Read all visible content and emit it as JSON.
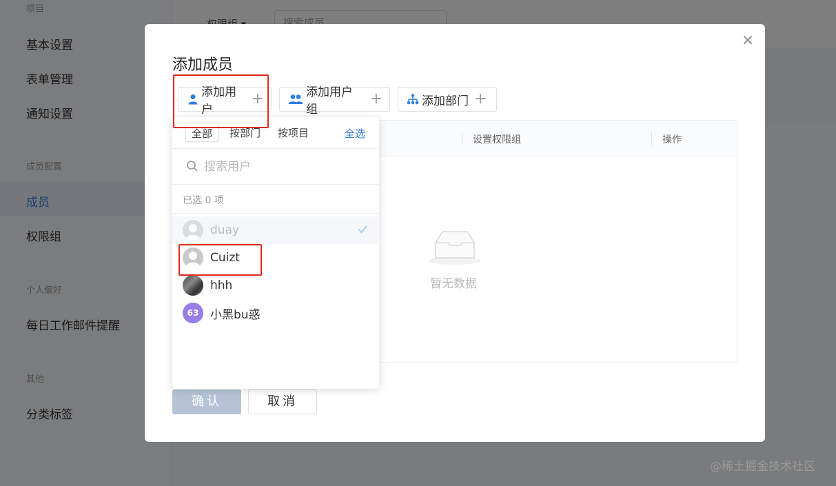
{
  "background": {
    "sidebar": {
      "sections": [
        {
          "title": "项目",
          "items": [
            "基本设置",
            "表单管理",
            "通知设置"
          ]
        },
        {
          "title": "成员配置",
          "items": [
            "成员",
            "权限组"
          ]
        },
        {
          "title": "个人偏好",
          "items": [
            "每日工作邮件提醒"
          ]
        },
        {
          "title": "其他",
          "items": [
            "分类标签"
          ]
        }
      ],
      "active_item": "成员"
    },
    "dropdown_label": "权限组 ▾",
    "search_placeholder": "搜索成员"
  },
  "modal": {
    "title": "添加成员",
    "close_icon": "×",
    "add_buttons": [
      {
        "label": "添加用户",
        "icon": "user-icon"
      },
      {
        "label": "添加用户组",
        "icon": "user-group-icon"
      },
      {
        "label": "添加部门",
        "icon": "department-icon"
      }
    ],
    "table": {
      "columns": [
        "设置权限组",
        "操作"
      ],
      "empty_text": "暂无数据"
    },
    "confirm_label": "确认",
    "cancel_label": "取消"
  },
  "user_panel": {
    "tabs": [
      "全部",
      "按部门",
      "按项目"
    ],
    "active_tab": "全部",
    "select_all_label": "全选",
    "search_placeholder": "搜索用户",
    "selected_text": "已选 0 项",
    "users": [
      {
        "name": "duay",
        "avatar": "default",
        "disabled": true,
        "checked": true
      },
      {
        "name": "Cuizt",
        "avatar": "default",
        "disabled": false,
        "checked": false
      },
      {
        "name": "hhh",
        "avatar": "photo",
        "disabled": false,
        "checked": false
      },
      {
        "name": "小黑bu惑",
        "avatar": "initials",
        "initials": "63",
        "disabled": false,
        "checked": false
      }
    ]
  },
  "watermark": "@稀土掘金技术社区",
  "colors": {
    "accent": "#2f7de1",
    "highlight_box": "#e0291c",
    "avatar_initials_bg": "#9a7de6"
  }
}
